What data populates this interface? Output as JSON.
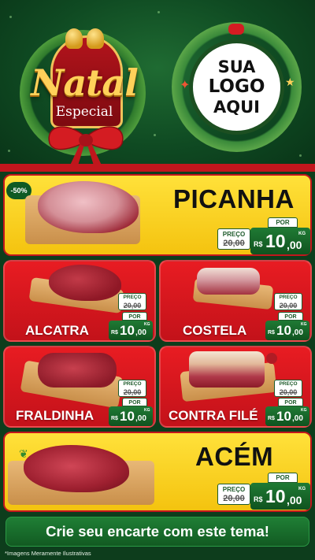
{
  "header": {
    "title": "Natal",
    "subtitle": "Especial",
    "logo_line1": "SUA",
    "logo_line2": "LOGO",
    "logo_line3": "AQUI"
  },
  "products": {
    "picanha": {
      "name": "PICANHA",
      "badge": "-50%",
      "preco_label": "PREÇO",
      "old_price": "20,00",
      "por_label": "POR",
      "currency": "R$",
      "price_int": "10",
      "price_dec": ",00",
      "unit": "KG"
    },
    "alcatra": {
      "name": "ALCATRA",
      "preco_label": "PREÇO",
      "old_price": "20,00",
      "por_label": "POR",
      "currency": "R$",
      "price_int": "10",
      "price_dec": ",00",
      "unit": "KG"
    },
    "costela": {
      "name": "COSTELA",
      "preco_label": "PREÇO",
      "old_price": "20,00",
      "por_label": "POR",
      "currency": "R$",
      "price_int": "10",
      "price_dec": ",00",
      "unit": "KG"
    },
    "fraldinha": {
      "name": "FRALDINHA",
      "preco_label": "PREÇO",
      "old_price": "20,00",
      "por_label": "POR",
      "currency": "R$",
      "price_int": "10",
      "price_dec": ",00",
      "unit": "KG"
    },
    "contrafile": {
      "name": "CONTRA FILÉ",
      "preco_label": "PREÇO",
      "old_price": "20,00",
      "por_label": "POR",
      "currency": "R$",
      "price_int": "10",
      "price_dec": ",00",
      "unit": "KG"
    },
    "acem": {
      "name": "ACÉM",
      "preco_label": "PREÇO",
      "old_price": "20,00",
      "por_label": "POR",
      "currency": "R$",
      "price_int": "10",
      "price_dec": ",00",
      "unit": "KG"
    }
  },
  "cta": {
    "label": "Crie seu encarte com este tema!"
  },
  "footnote": "*Imagens Meramente Ilustrativas",
  "colors": {
    "red": "#c3121a",
    "yellow": "#f4c30f",
    "green": "#10531f",
    "gold": "#ffd15a"
  }
}
